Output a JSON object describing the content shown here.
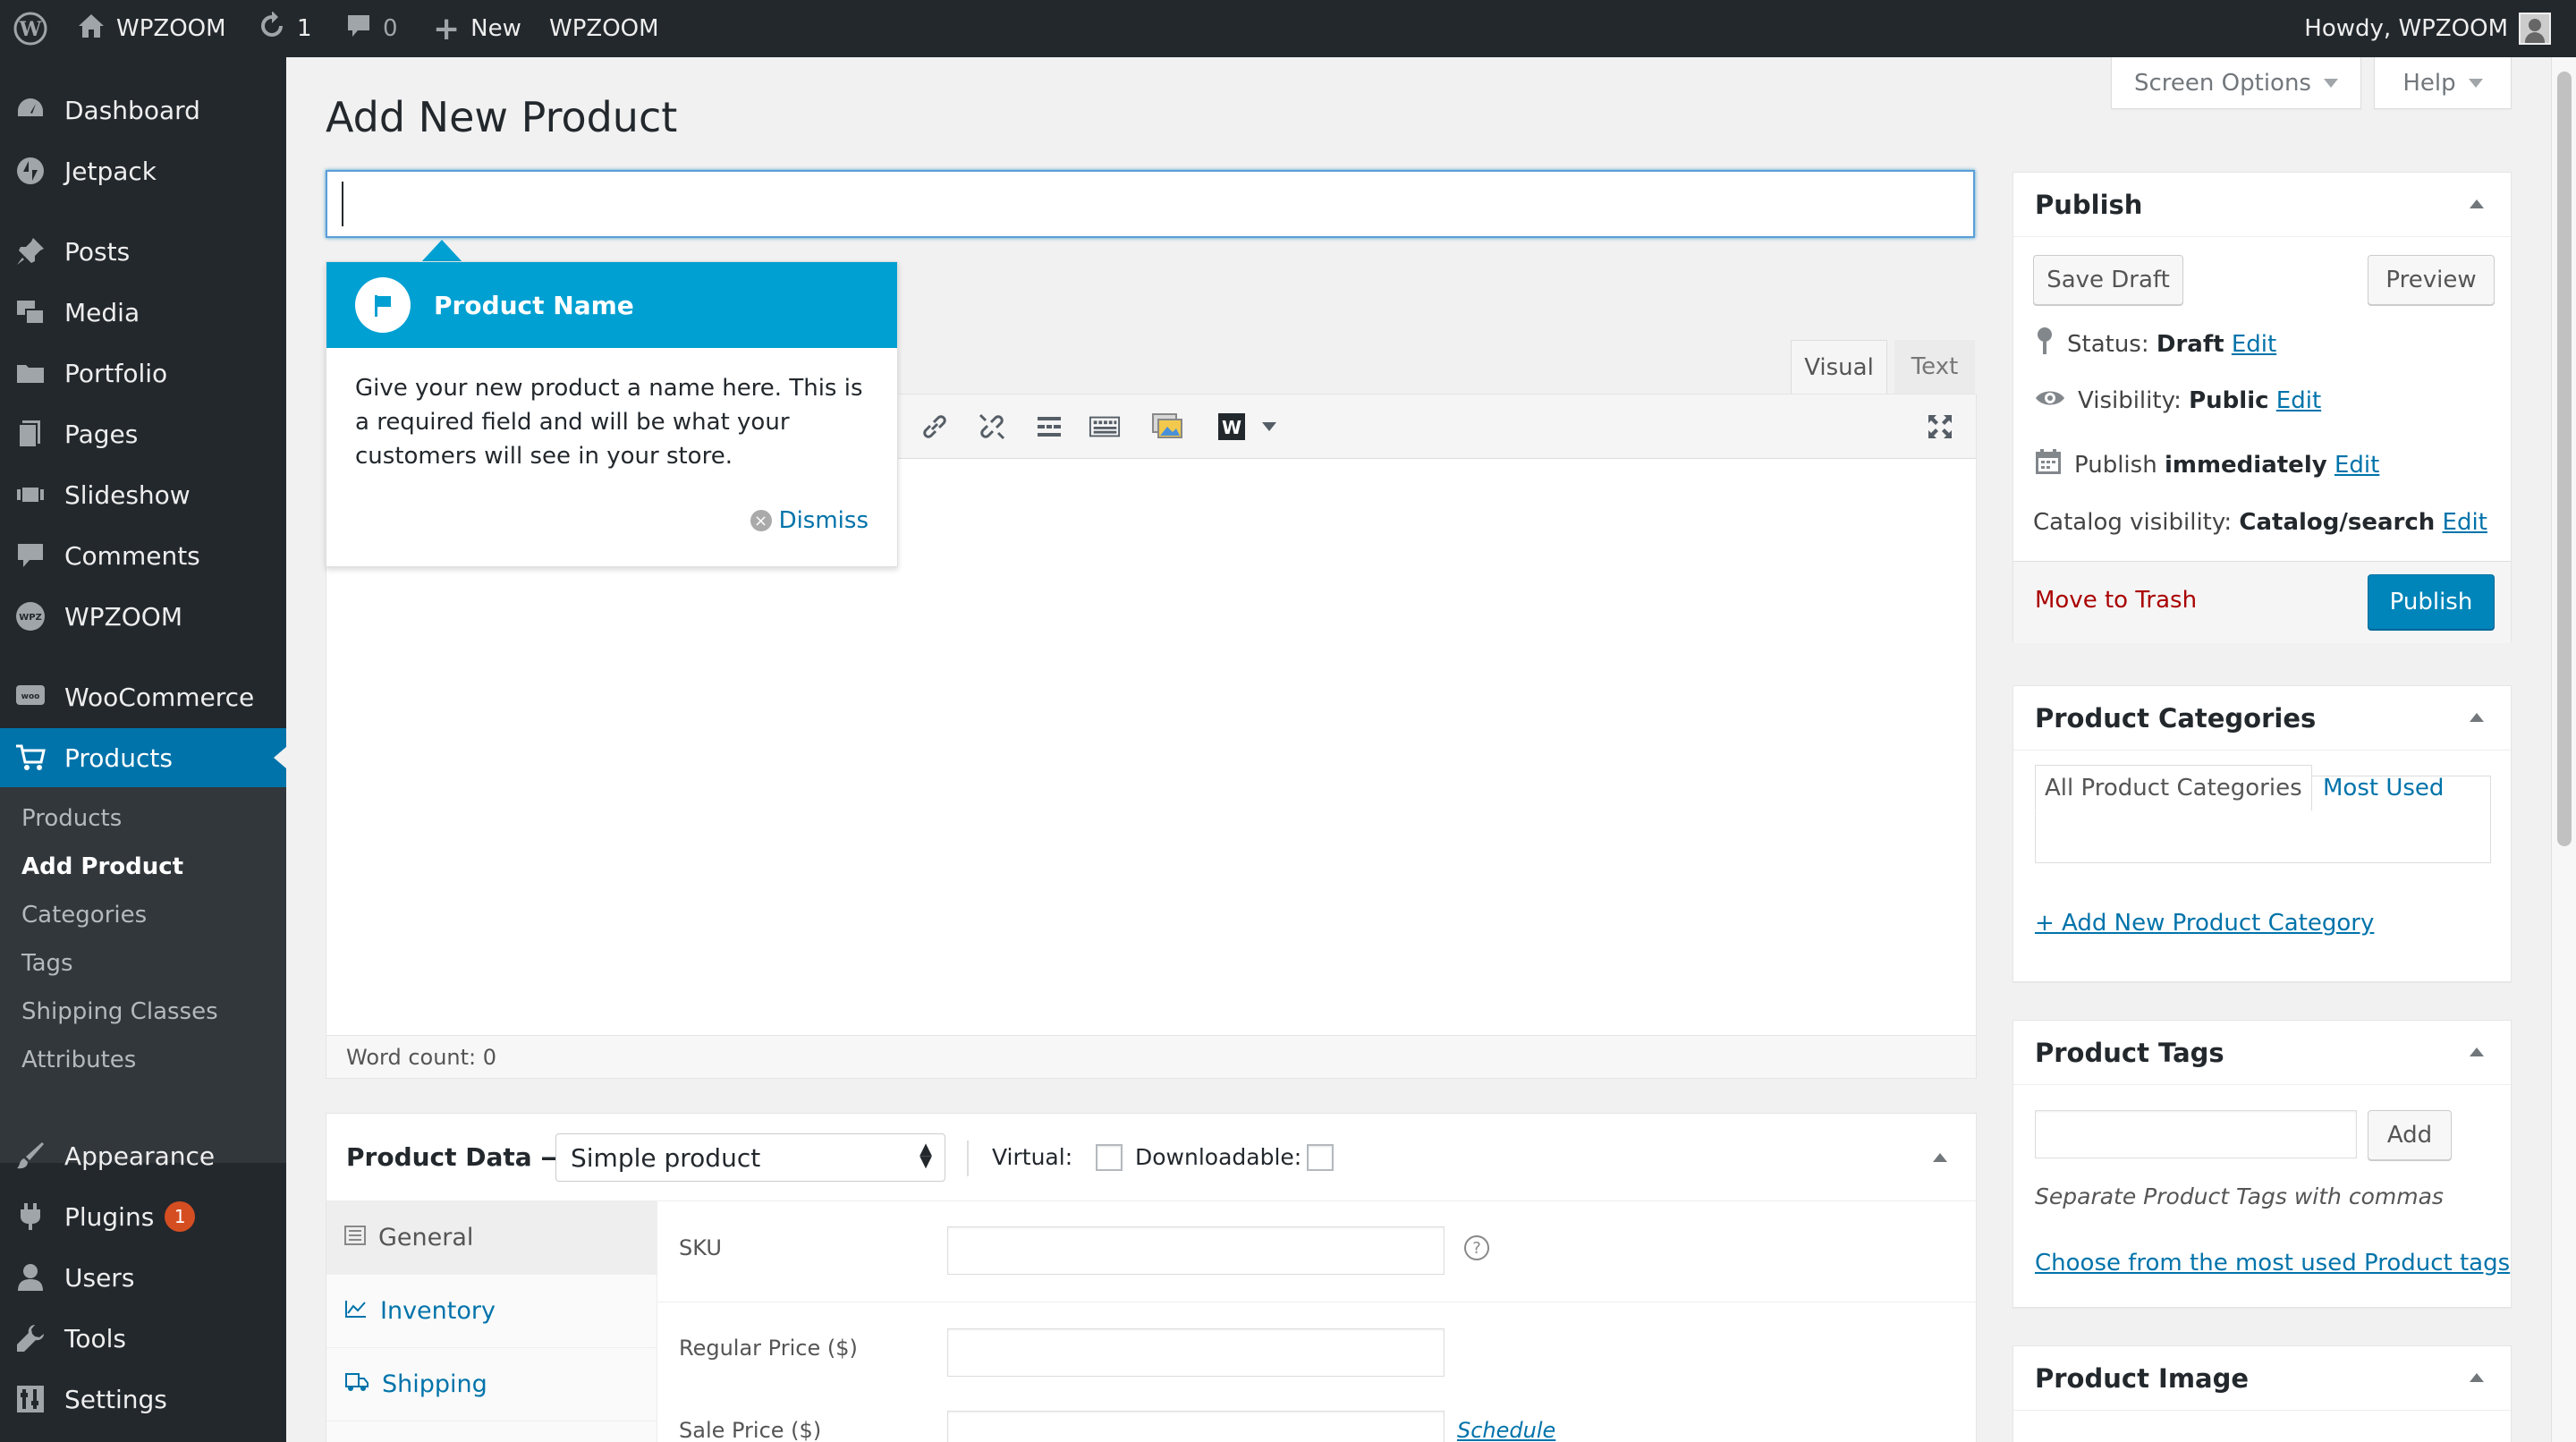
{
  "adminbar": {
    "site_name": "WPZOOM",
    "updates_count": "1",
    "comments_count": "0",
    "new_label": "New",
    "extra_label": "WPZOOM",
    "howdy": "Howdy, WPZOOM"
  },
  "sidebar": {
    "items": [
      {
        "label": "Dashboard",
        "icon": "dashboard-icon"
      },
      {
        "label": "Jetpack",
        "icon": "jetpack-icon"
      },
      {
        "label": "Posts",
        "icon": "pin-icon"
      },
      {
        "label": "Media",
        "icon": "media-icon"
      },
      {
        "label": "Portfolio",
        "icon": "folder-icon"
      },
      {
        "label": "Pages",
        "icon": "pages-icon"
      },
      {
        "label": "Slideshow",
        "icon": "slideshow-icon"
      },
      {
        "label": "Comments",
        "icon": "comment-icon"
      },
      {
        "label": "WPZOOM",
        "icon": "wpzoom-icon"
      },
      {
        "label": "WooCommerce",
        "icon": "woo-icon"
      },
      {
        "label": "Products",
        "icon": "cart-icon"
      },
      {
        "label": "Appearance",
        "icon": "brush-icon"
      },
      {
        "label": "Plugins",
        "icon": "plugin-icon",
        "badge": "1"
      },
      {
        "label": "Users",
        "icon": "user-icon"
      },
      {
        "label": "Tools",
        "icon": "wrench-icon"
      },
      {
        "label": "Settings",
        "icon": "settings-icon"
      }
    ],
    "submenu": [
      "Products",
      "Add Product",
      "Categories",
      "Tags",
      "Shipping Classes",
      "Attributes"
    ]
  },
  "top": {
    "screen_options": "Screen Options",
    "help": "Help"
  },
  "page_title": "Add New Product",
  "title_input": {
    "value": ""
  },
  "pointer": {
    "title": "Product Name",
    "body": "Give your new product a name here. This is a required field and will be what your customers will see in your store.",
    "dismiss": "Dismiss"
  },
  "editor": {
    "tab_visual": "Visual",
    "tab_text": "Text",
    "word_count": "Word count: 0"
  },
  "product_data": {
    "title": "Product Data —",
    "type_selected": "Simple product",
    "virtual_label": "Virtual:",
    "downloadable_label": "Downloadable:",
    "tabs": [
      "General",
      "Inventory",
      "Shipping"
    ],
    "sku_label": "SKU",
    "regular_price_label": "Regular Price ($)",
    "sale_price_label": "Sale Price ($)",
    "schedule": "Schedule"
  },
  "publish_box": {
    "title": "Publish",
    "save_draft": "Save Draft",
    "preview": "Preview",
    "status_label": "Status:",
    "status_value": "Draft",
    "visibility_label": "Visibility:",
    "visibility_value": "Public",
    "publish_label": "Publish",
    "publish_value": "immediately",
    "catalog_label": "Catalog visibility:",
    "catalog_value": "Catalog/search",
    "edit": "Edit",
    "trash": "Move to Trash",
    "publish_button": "Publish"
  },
  "categories_box": {
    "title": "Product Categories",
    "tab_all": "All Product Categories",
    "tab_most_used": "Most Used",
    "add_new": "+ Add New Product Category"
  },
  "tags_box": {
    "title": "Product Tags",
    "add": "Add",
    "hint": "Separate Product Tags with commas",
    "choose": "Choose from the most used Product tags"
  },
  "image_box": {
    "title": "Product Image"
  },
  "colors": {
    "accent": "#0073aa",
    "pointer": "#00a0d2",
    "admin_dark": "#23282d",
    "trash": "#aa0000"
  }
}
